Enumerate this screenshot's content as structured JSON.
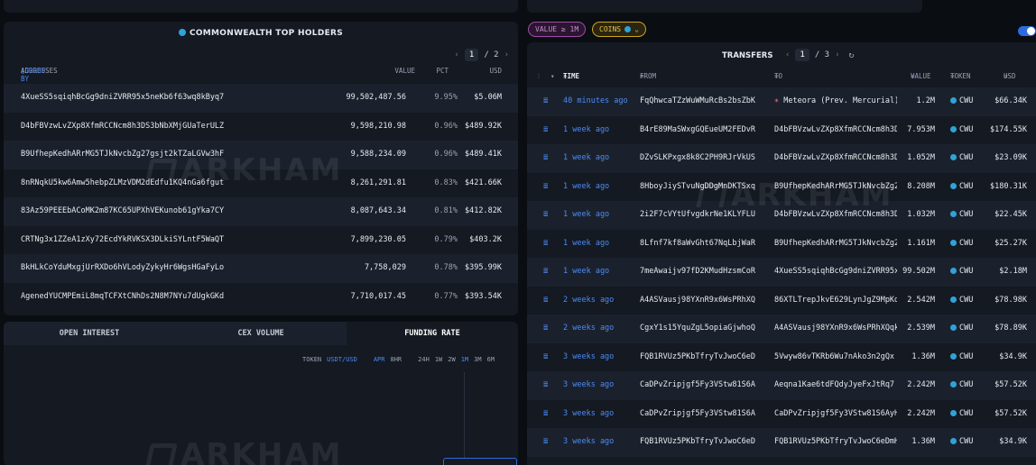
{
  "holders": {
    "title": "COMMONWEALTH TOP HOLDERS",
    "page": "1",
    "page_total": "/ 2",
    "columns": {
      "addresses": "ADDRESSES",
      "group": "[GROUP BY ENTITY]",
      "value": "VALUE",
      "pct": "PCT",
      "usd": "USD"
    },
    "rows": [
      {
        "addr": "4XueSS5sqiqhBcGg9dniZVRR95x5neKb6f63wq8kByq7",
        "value": "99,502,487.56",
        "pct": "9.95%",
        "usd": "$5.06M"
      },
      {
        "addr": "D4bFBVzwLvZXp8XfmRCCNcm8h3DS3bNbXMjGUaTerULZ",
        "value": "9,598,210.98",
        "pct": "0.96%",
        "usd": "$489.92K"
      },
      {
        "addr": "B9UfhepKedhARrMG5TJkNvcbZg27gsjt2kTZaLGVw3hF",
        "value": "9,588,234.09",
        "pct": "0.96%",
        "usd": "$489.41K"
      },
      {
        "addr": "8nRNqkU5kw6Amw5hebpZLMzVDM2dEdfu1KQ4nGa6fgut",
        "value": "8,261,291.81",
        "pct": "0.83%",
        "usd": "$421.66K"
      },
      {
        "addr": "83Az59PEEEbACoMK2m87KC65UPXhVEKunob61gYka7CY",
        "value": "8,087,643.34",
        "pct": "0.81%",
        "usd": "$412.82K"
      },
      {
        "addr": "CRTNg3x1ZZeA1zXy72EcdYkRVKSX3DLkiSYLntF5WaQT",
        "value": "7,899,230.05",
        "pct": "0.79%",
        "usd": "$403.2K"
      },
      {
        "addr": "BkHLkCoYduMxgjUrRXDo6hVLodyZykyHr6WgsHGaFyLo",
        "value": "7,758,029",
        "pct": "0.78%",
        "usd": "$395.99K"
      },
      {
        "addr": "AgenedYUCMPEmiL8mqTCFXtCNhDs2N8M7NYu7dUgkGKd",
        "value": "7,710,017.45",
        "pct": "0.77%",
        "usd": "$393.54K"
      }
    ]
  },
  "funding": {
    "tabs": [
      "OPEN INTEREST",
      "CEX VOLUME",
      "FUNDING RATE"
    ],
    "active_tab": 2,
    "toolbar": {
      "token": "TOKEN",
      "pair": "USDT/USD",
      "apr": "APR",
      "hr": "8HR",
      "ranges": [
        "24H",
        "1W",
        "2W",
        "1M",
        "3M",
        "6M"
      ],
      "active_range": "1M"
    }
  },
  "filters": {
    "value_chip": "VALUE ≥ 1M",
    "coins_chip": "COINS",
    "coins_caret": "⌄"
  },
  "transfers": {
    "title": "TRANSFERS",
    "page": "1",
    "page_total": "/ 3",
    "columns": {
      "time": "TIME",
      "from": "FROM",
      "to": "TO",
      "value": "VALUE",
      "token": "TOKEN",
      "usd": "USD"
    },
    "rows": [
      {
        "time": "40 minutes ago",
        "from": "FqQhwcaTZzWuWMuRcBs2bsZbK9",
        "to": "Meteora (Prev. Mercurial)",
        "to_entity": true,
        "value": "1.2M",
        "token": "CWU",
        "usd": "$66.34K"
      },
      {
        "time": "1 week ago",
        "from": "B4rE89MaSWxgGQEueUM2FEDvR",
        "to": "D4bFBVzwLvZXp8XfmRCCNcm8h3DS",
        "value": "7.953M",
        "token": "CWU",
        "usd": "$174.55K"
      },
      {
        "time": "1 week ago",
        "from": "DZvSLKPxgx8k8C2PH9RJrVkUSt",
        "to": "D4bFBVzwLvZXp8XfmRCCNcm8h3DS",
        "value": "1.052M",
        "token": "CWU",
        "usd": "$23.09K"
      },
      {
        "time": "1 week ago",
        "from": "8HboyJiySTvuNgDDgMnDKTSxqT",
        "to": "B9UfhepKedhARrMG5TJkNvcbZg27",
        "value": "8.208M",
        "token": "CWU",
        "usd": "$180.31K"
      },
      {
        "time": "1 week ago",
        "from": "2i2F7cVYtUfvgdkrNe1KLYFLUq",
        "to": "D4bFBVzwLvZXp8XfmRCCNcm8h3DS",
        "value": "1.032M",
        "token": "CWU",
        "usd": "$22.45K"
      },
      {
        "time": "1 week ago",
        "from": "8Lfnf7kf8aWvGht67NqLbjWaRn",
        "to": "B9UfhepKedhARrMG5TJkNvcbZg27",
        "value": "1.161M",
        "token": "CWU",
        "usd": "$25.27K"
      },
      {
        "time": "1 week ago",
        "from": "7meAwaijv97fD2KMudHzsmCoRb",
        "to": "4XueSS5sqiqhBcGg9dniZVRR95x5",
        "value": "99.502M",
        "token": "CWU",
        "usd": "$2.18M"
      },
      {
        "time": "2 weeks ago",
        "from": "A4ASVausj98YXnR9x6WsPRhXQq",
        "to": "86XTLTrepJkvE629LynJgZ9MpKd",
        "value": "2.542M",
        "token": "CWU",
        "usd": "$78.98K"
      },
      {
        "time": "2 weeks ago",
        "from": "CgxY1s15YquZgL5opiaGjwhoQe",
        "to": "A4ASVausj98YXnR9x6WsPRhXQqkF",
        "value": "2.539M",
        "token": "CWU",
        "usd": "$78.89K"
      },
      {
        "time": "3 weeks ago",
        "from": "FQB1RVUz5PKbTfryTvJwoC6eDm",
        "to": "5Vwyw86vTKRb6Wu7nAko3n2gQx",
        "value": "1.36M",
        "token": "CWU",
        "usd": "$34.9K"
      },
      {
        "time": "3 weeks ago",
        "from": "CaDPvZripjgf5Fy3VStw81S6Ay",
        "to": "Aeqna1Kae6tdFQdyJyeFxJtRq7",
        "value": "2.242M",
        "token": "CWU",
        "usd": "$57.52K"
      },
      {
        "time": "3 weeks ago",
        "from": "CaDPvZripjgf5Fy3VStw81S6Ay",
        "to": "CaDPvZripjgf5Fy3VStw81S6AyH8",
        "value": "2.242M",
        "token": "CWU",
        "usd": "$57.52K"
      },
      {
        "time": "3 weeks ago",
        "from": "FQB1RVUz5PKbTfryTvJwoC6eDm",
        "to": "FQB1RVUz5PKbTfryTvJwoC6eDmHy",
        "value": "1.36M",
        "token": "CWU",
        "usd": "$34.9K"
      }
    ]
  },
  "watermark": "ARKHAM",
  "colors": {
    "accent": "#4c8bf5",
    "token": "#2ea3d8",
    "value_chip": "#a04aa6",
    "coins_chip": "#c9a520"
  }
}
